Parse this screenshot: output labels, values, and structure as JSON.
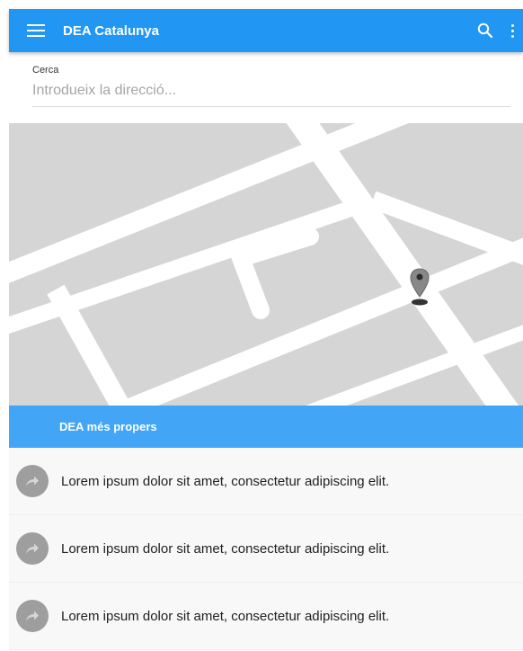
{
  "appbar": {
    "title": "DEA Catalunya",
    "menu_icon": "menu-icon",
    "search_icon": "search-icon",
    "more_icon": "more-vert-icon",
    "color": "#2196f3"
  },
  "search": {
    "label": "Cerca",
    "placeholder": "Introdueix la direcció...",
    "value": ""
  },
  "map": {
    "marker_icon": "map-pin-icon",
    "background": "#d5d5d5"
  },
  "section": {
    "title": "DEA més propers",
    "color": "#42a5f5"
  },
  "list": {
    "items": [
      {
        "icon": "directions-icon",
        "text": "Lorem ipsum dolor sit amet, consectetur adipiscing elit."
      },
      {
        "icon": "directions-icon",
        "text": "Lorem ipsum dolor sit amet, consectetur adipiscing elit."
      },
      {
        "icon": "directions-icon",
        "text": "Lorem ipsum dolor sit amet, consectetur adipiscing elit."
      }
    ]
  }
}
